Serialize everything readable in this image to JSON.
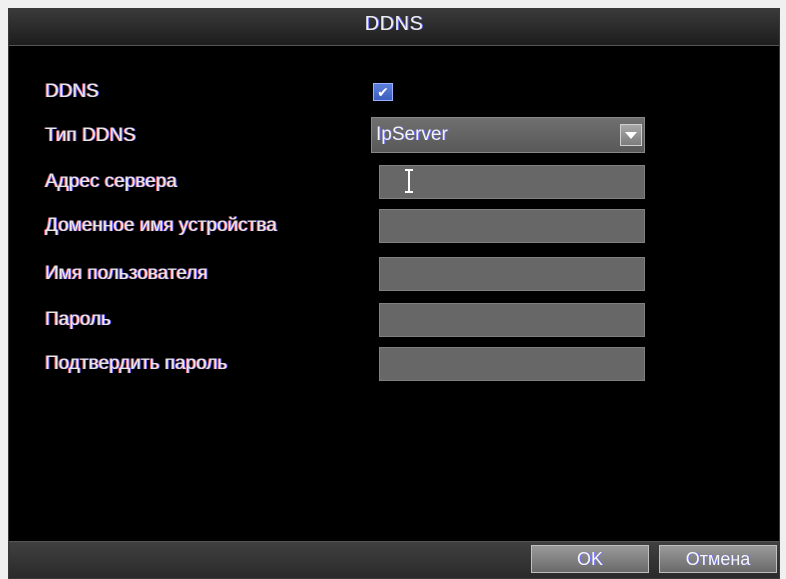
{
  "window": {
    "title": "DDNS"
  },
  "form": {
    "ddns": {
      "label": "DDNS",
      "checked": true
    },
    "ddns_type": {
      "label": "Тип DDNS",
      "value": "IpServer"
    },
    "server_address": {
      "label": "Адрес сервера",
      "value": ""
    },
    "device_domain": {
      "label": "Доменное имя устройства",
      "value": ""
    },
    "username": {
      "label": "Имя пользователя",
      "value": ""
    },
    "password": {
      "label": "Пароль",
      "value": ""
    },
    "confirm_password": {
      "label": "Подтвердить пароль",
      "value": ""
    }
  },
  "buttons": {
    "ok": "OK",
    "cancel": "Отмена"
  },
  "colors": {
    "background": "#000000",
    "field": "#676767",
    "accent": "#3c5fc0"
  }
}
